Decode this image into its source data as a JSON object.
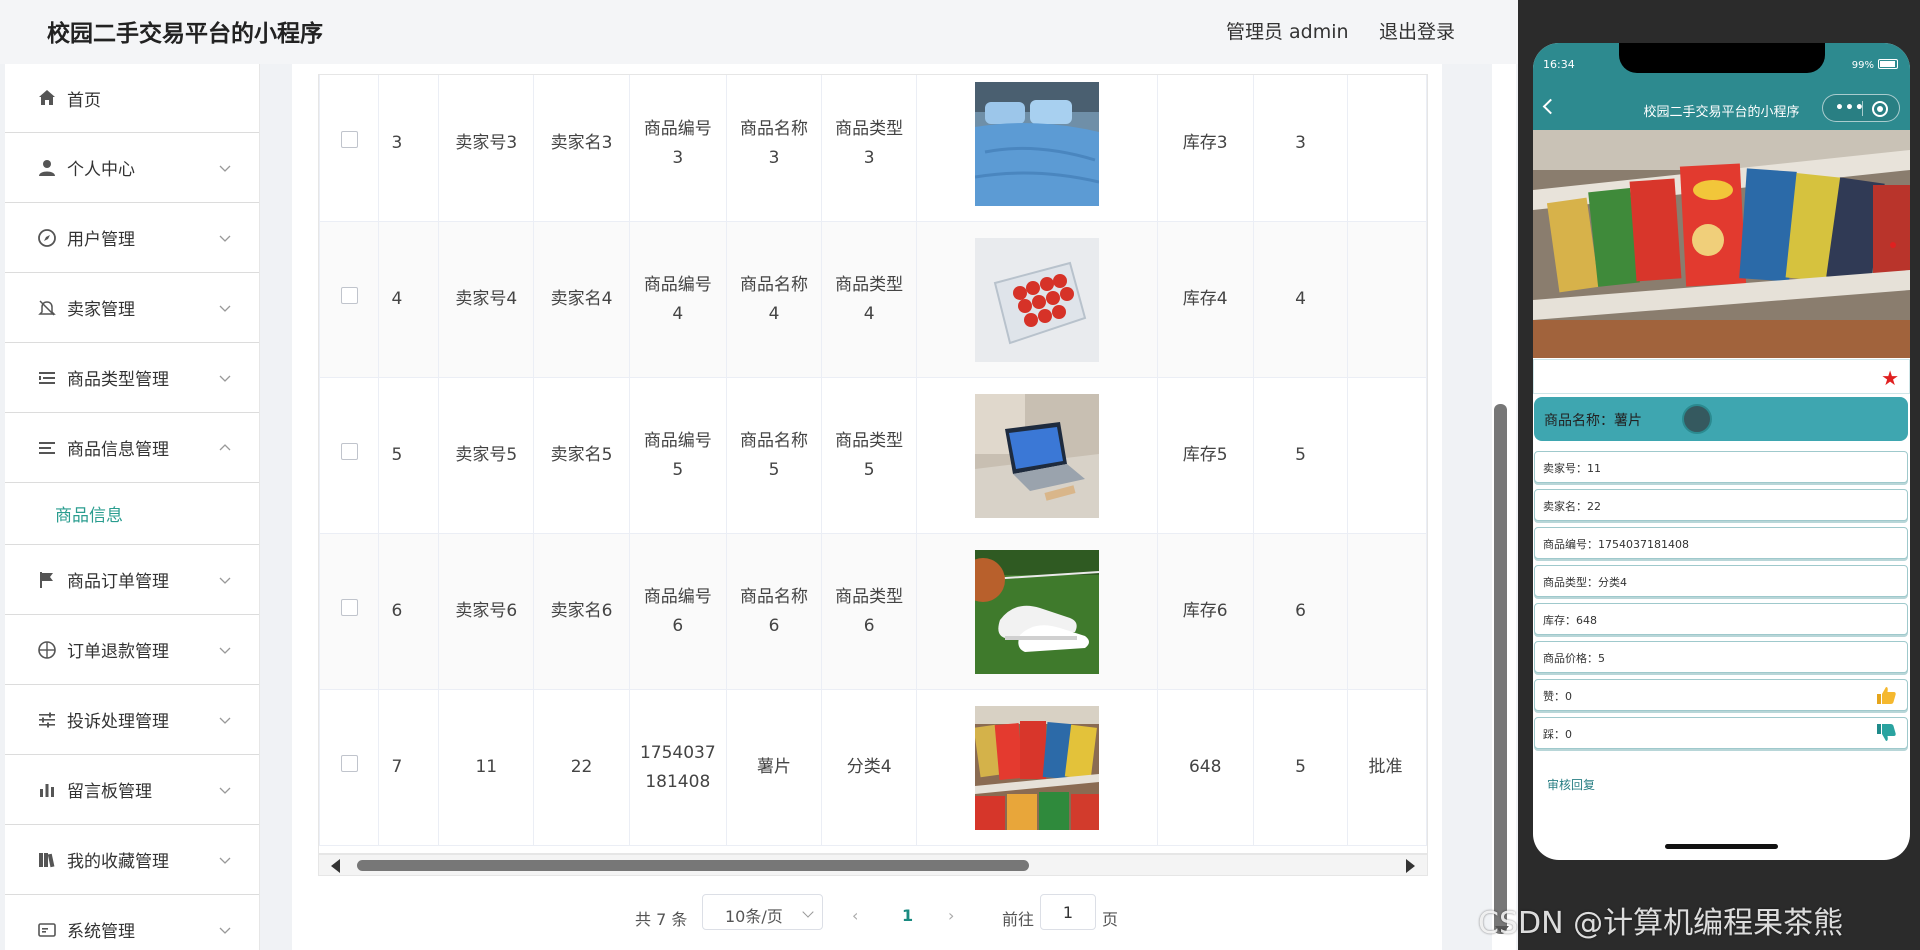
{
  "header": {
    "title": "校园二手交易平台的小程序",
    "user": "管理员 admin",
    "logout": "退出登录"
  },
  "sidebar": {
    "items": [
      {
        "label": "首页",
        "icon": "home-icon"
      },
      {
        "label": "个人中心",
        "icon": "user-icon"
      },
      {
        "label": "用户管理",
        "icon": "compass-icon"
      },
      {
        "label": "卖家管理",
        "icon": "bell-off-icon"
      },
      {
        "label": "商品类型管理",
        "icon": "list-icon"
      },
      {
        "label": "商品信息管理",
        "icon": "menu-icon"
      },
      {
        "label": "商品订单管理",
        "icon": "flag-icon"
      },
      {
        "label": "订单退款管理",
        "icon": "target-icon"
      },
      {
        "label": "投诉处理管理",
        "icon": "sliders-icon"
      },
      {
        "label": "留言板管理",
        "icon": "bar-chart-icon"
      },
      {
        "label": "我的收藏管理",
        "icon": "books-icon"
      },
      {
        "label": "系统管理",
        "icon": "card-icon"
      }
    ],
    "submenu": {
      "label": "商品信息"
    }
  },
  "table": {
    "rows": [
      {
        "id": "3",
        "seller_no": "卖家号3",
        "seller_name": "卖家名3",
        "goods_no": "商品编号\n3",
        "goods_name": "商品名称\n3",
        "goods_type": "商品类型\n3",
        "image": "bedding-photo",
        "stock": "库存3",
        "price": "3",
        "status": ""
      },
      {
        "id": "4",
        "seller_no": "卖家号4",
        "seller_name": "卖家名4",
        "goods_no": "商品编号\n4",
        "goods_name": "商品名称\n4",
        "goods_type": "商品类型\n4",
        "image": "strawberries-photo",
        "stock": "库存4",
        "price": "4",
        "status": ""
      },
      {
        "id": "5",
        "seller_no": "卖家号5",
        "seller_name": "卖家名5",
        "goods_no": "商品编号\n5",
        "goods_name": "商品名称\n5",
        "goods_type": "商品类型\n5",
        "image": "laptop-photo",
        "stock": "库存5",
        "price": "5",
        "status": ""
      },
      {
        "id": "6",
        "seller_no": "卖家号6",
        "seller_name": "卖家名6",
        "goods_no": "商品编号\n6",
        "goods_name": "商品名称\n6",
        "goods_type": "商品类型\n6",
        "image": "sneakers-photo",
        "stock": "库存6",
        "price": "6",
        "status": ""
      },
      {
        "id": "7",
        "seller_no": "11",
        "seller_name": "22",
        "goods_no": "1754037\n181408",
        "goods_name": "薯片",
        "goods_type": "分类4",
        "image": "chips-photo",
        "stock": "648",
        "price": "5",
        "status": "批准"
      }
    ]
  },
  "pagination": {
    "total": "共 7 条",
    "page_size": "10条/页",
    "prev": "‹",
    "current": "1",
    "next": "›",
    "goto_label": "前往",
    "goto_value": "1",
    "page_suffix": "页"
  },
  "phone": {
    "time": "16:34",
    "battery": "99%",
    "nav_title": "校园二手交易平台的小程序",
    "capsule_dots": "•••",
    "name_label": "商品名称：薯片",
    "fields": [
      {
        "text": "卖家号：11"
      },
      {
        "text": "卖家名：22"
      },
      {
        "text": "商品编号：1754037181408"
      },
      {
        "text": "商品类型：分类4"
      },
      {
        "text": "库存：648"
      },
      {
        "text": "商品价格：5"
      },
      {
        "text": "赞：0",
        "icon": "thumbs-up-icon"
      },
      {
        "text": "踩：0",
        "icon": "thumbs-down-icon"
      }
    ],
    "review_link": "审核回复"
  },
  "watermark": "CSDN @计算机编程果茶熊",
  "colors": {
    "accent": "#2d8a8f",
    "accent_light": "#3ea6b0",
    "active_submenu": "#2a9d8f",
    "favorite_star": "#e02020"
  }
}
